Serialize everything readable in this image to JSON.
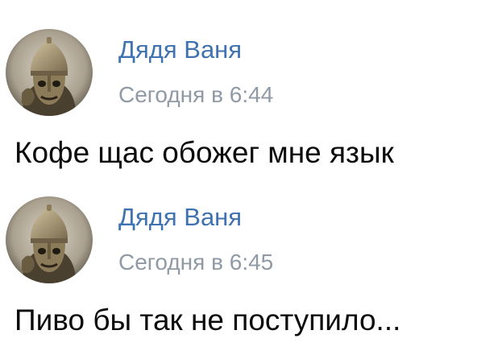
{
  "posts": [
    {
      "author": "Дядя Ваня",
      "time": "Сегодня в 6:44",
      "text": "Кофе щас обожег мне язык",
      "avatar_icon": "knight-chess-piece-avatar"
    },
    {
      "author": "Дядя Ваня",
      "time": "Сегодня в 6:45",
      "text": "Пиво бы так не поступило...",
      "avatar_icon": "knight-chess-piece-avatar"
    }
  ],
  "colors": {
    "author_name": "#3f72b0",
    "timestamp": "#8f9aa5",
    "message_text": "#0b0b0b",
    "background": "#ffffff"
  }
}
